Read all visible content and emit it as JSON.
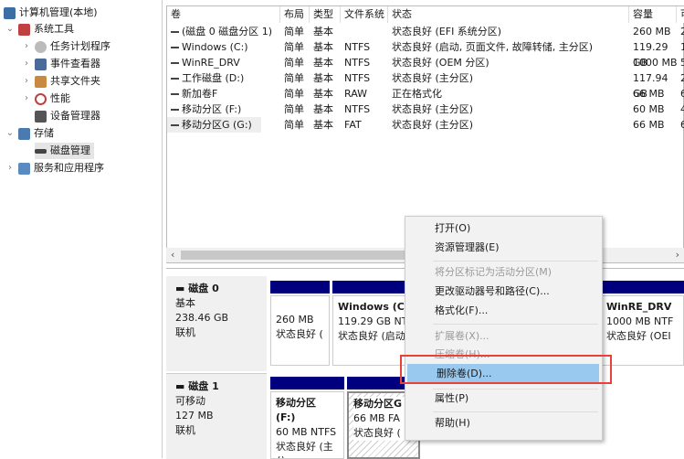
{
  "tree": {
    "items": [
      {
        "label": "计算机管理(本地)",
        "icon": "computer-management-icon",
        "color": "#3a6ea5"
      },
      {
        "label": "系统工具",
        "icon": "tools-icon",
        "color": "#c04040"
      },
      {
        "label": "任务计划程序",
        "icon": "clock-icon",
        "color": "#8a8a8a"
      },
      {
        "label": "事件查看器",
        "icon": "event-viewer-icon",
        "color": "#4a6a9a"
      },
      {
        "label": "共享文件夹",
        "icon": "shared-folder-icon",
        "color": "#c88a40"
      },
      {
        "label": "性能",
        "icon": "performance-icon",
        "color": "#c04040"
      },
      {
        "label": "设备管理器",
        "icon": "device-manager-icon",
        "color": "#555"
      },
      {
        "label": "存储",
        "icon": "storage-icon",
        "color": "#4a7ab0"
      },
      {
        "label": "磁盘管理",
        "icon": "disk-management-icon",
        "color": "#444"
      },
      {
        "label": "服务和应用程序",
        "icon": "services-icon",
        "color": "#5a8ac0"
      }
    ]
  },
  "table": {
    "headers": [
      "卷",
      "布局",
      "类型",
      "文件系统",
      "状态",
      "容量",
      "可"
    ],
    "rows": [
      [
        "(磁盘 0 磁盘分区 1)",
        "简单",
        "基本",
        "",
        "状态良好 (EFI 系统分区)",
        "260 MB",
        "2"
      ],
      [
        "Windows (C:)",
        "简单",
        "基本",
        "NTFS",
        "状态良好 (启动, 页面文件, 故障转储, 主分区)",
        "119.29 GB",
        "1"
      ],
      [
        "WinRE_DRV",
        "简单",
        "基本",
        "NTFS",
        "状态良好 (OEM 分区)",
        "1000 MB",
        "5"
      ],
      [
        "工作磁盘 (D:)",
        "简单",
        "基本",
        "NTFS",
        "状态良好 (主分区)",
        "117.94 GB",
        "2"
      ],
      [
        "新加卷F",
        "简单",
        "基本",
        "RAW",
        "正在格式化",
        "66 MB",
        "6"
      ],
      [
        "移动分区 (F:)",
        "简单",
        "基本",
        "NTFS",
        "状态良好 (主分区)",
        "60 MB",
        "4"
      ],
      [
        "移动分区G (G:)",
        "简单",
        "基本",
        "FAT",
        "状态良好 (主分区)",
        "66 MB",
        "6"
      ]
    ]
  },
  "disks": [
    {
      "name": "磁盘 0",
      "type": "基本",
      "size": "238.46 GB",
      "status": "联机",
      "parts": [
        {
          "name": "",
          "size": "260 MB",
          "status": "状态良好 ("
        },
        {
          "name": "Windows (C",
          "size": "119.29 GB NT",
          "status": "状态良好 (启动"
        },
        {
          "name": "WinRE_DRV",
          "size": "1000 MB NTF",
          "status": "状态良好 (OEI"
        }
      ]
    },
    {
      "name": "磁盘 1",
      "type": "可移动",
      "size": "127 MB",
      "status": "联机",
      "parts": [
        {
          "name": "移动分区 (F:)",
          "size": "60 MB NTFS",
          "status": "状态良好 (主分"
        },
        {
          "name": "移动分区G",
          "size": "66 MB FA",
          "status": "状态良好 ("
        }
      ]
    }
  ],
  "menu": {
    "items": [
      {
        "label": "打开(O)",
        "enabled": true
      },
      {
        "label": "资源管理器(E)",
        "enabled": true
      },
      {
        "label": "将分区标记为活动分区(M)",
        "enabled": false
      },
      {
        "label": "更改驱动器号和路径(C)...",
        "enabled": true
      },
      {
        "label": "格式化(F)...",
        "enabled": true
      },
      {
        "label": "扩展卷(X)...",
        "enabled": false
      },
      {
        "label": "压缩卷(H)...",
        "enabled": false
      },
      {
        "label": "删除卷(D)...",
        "enabled": true,
        "highlighted": true
      },
      {
        "label": "属性(P)",
        "enabled": true
      },
      {
        "label": "帮助(H)",
        "enabled": true
      }
    ]
  },
  "colors": {
    "partition_bar": "#00007f",
    "highlight": "#99c9ef",
    "annotation": "#e8413c"
  }
}
